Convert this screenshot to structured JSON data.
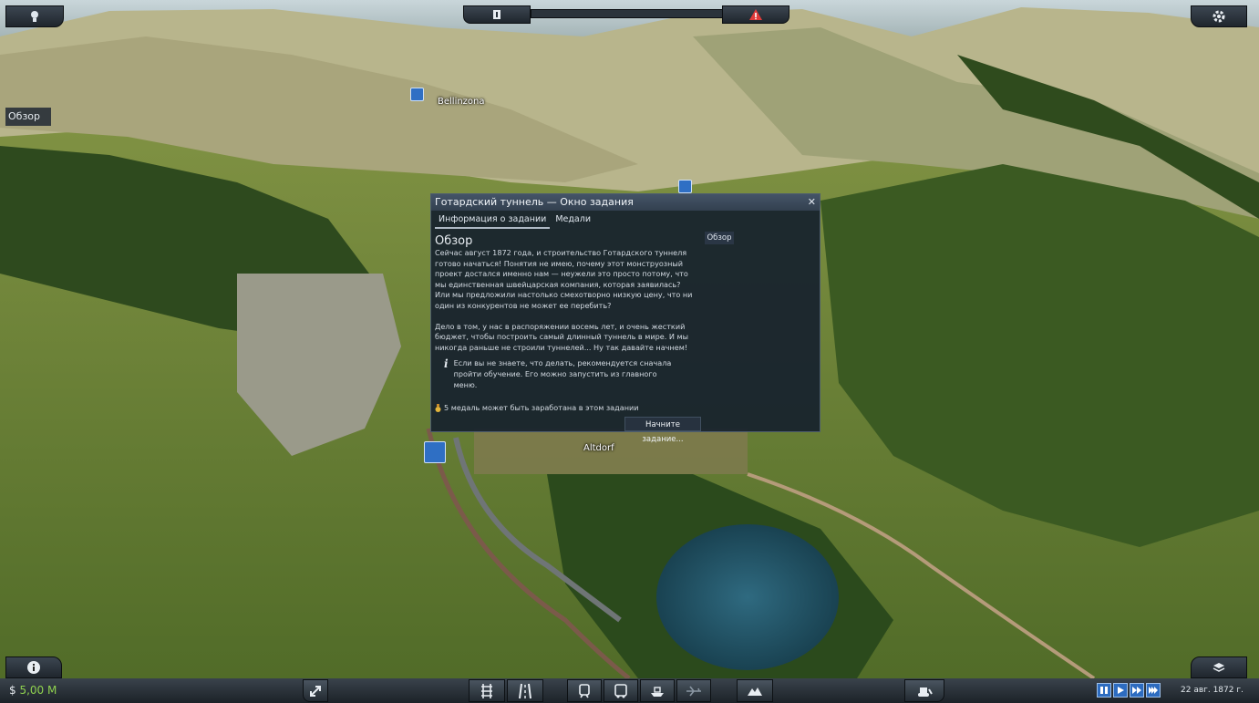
{
  "hud": {
    "overview_label": "Обзор",
    "money_symbol": "$",
    "money_value": "5,00 M",
    "date": "22 авг. 1872 г."
  },
  "map": {
    "towns": [
      "Bellinzona",
      "Altdorf"
    ]
  },
  "dialog": {
    "title": "Готардский туннель — Окно задания",
    "tabs": [
      "Информация о задании",
      "Медали"
    ],
    "heading": "Обзор",
    "side_button": "Обзор",
    "paragraph1": "Сейчас август 1872 года, и строительство Готардского туннеля готово начаться! Понятия не имею, почему этот монструозный проект достался именно нам — неужели это просто потому, что мы единственная швейцарская компания, которая заявилась? Или мы предложили настолько смехотворно низкую цену, что ни один из конкурентов не может ее перебить?",
    "paragraph2": "Дело в том, у нас в распоряжении восемь лет, и очень жесткий бюджет, чтобы построить самый длинный туннель в мире. И мы никогда раньше не строили туннелей... Ну так давайте начнем!",
    "hint": "Если вы не знаете, что делать, рекомендуется сначала пройти обучение. Его можно запустить из главного меню.",
    "medal_text": "5 медаль может быть заработана в этом задании",
    "start_button": "Начните задание..."
  },
  "icons": {
    "top_left": "lightbulb-icon",
    "top_right": "gear-icon",
    "top_center_left": "info-icon",
    "top_center_right": "warning-icon",
    "bottom_left": "info-icon",
    "bottom_right": "layers-icon",
    "toolbar": [
      "rail-track-icon",
      "road-icon",
      "train-icon",
      "bus-icon",
      "ship-icon",
      "plane-icon",
      "terrain-icon",
      "bulldozer-icon",
      "collapse-icon"
    ]
  },
  "colors": {
    "money": "#8fd14f",
    "selected": "#2e6fb6",
    "warning": "#e03a3a"
  }
}
